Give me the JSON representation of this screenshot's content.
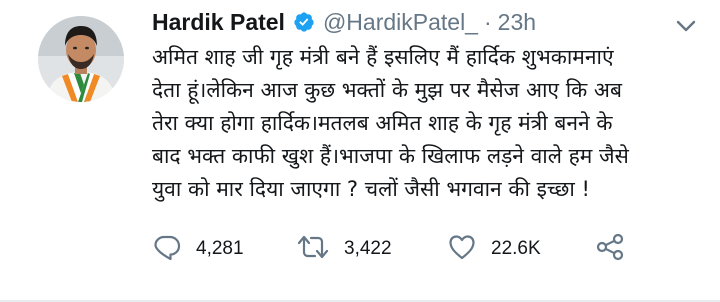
{
  "tweet": {
    "author_name": "Hardik Patel",
    "handle": "@HardikPatel_",
    "separator": "·",
    "time": "23h",
    "lines": [
      "अमित शाह जी गृह मंत्री बने हैं इसलिए मैं हार्दिक शुभकामनाएं",
      "देता हूं।लेकिन आज कुछ भक्तों के मुझ पर मैसेज आए कि अब",
      "तेरा क्या होगा हार्दिक।मतलब अमित शाह के गृह मंत्री बनने के",
      "बाद भक्त काफी खुश हैं।भाजपा के खिलाफ लड़ने वाले हम जैसे",
      "युवा को मार दिया जाएगा ? चलों जैसी भगवान की इच्छा !"
    ]
  },
  "actions": {
    "reply_count": "4,281",
    "retweet_count": "3,422",
    "like_count": "22.6K"
  },
  "icons": {
    "verified": "verified-badge-icon",
    "caret": "chevron-down-icon",
    "reply": "reply-icon",
    "retweet": "retweet-icon",
    "like": "heart-icon",
    "share": "share-icon"
  },
  "colors": {
    "text": "#14171a",
    "secondary": "#657786",
    "verified": "#1da1f2",
    "icon": "#657786"
  }
}
